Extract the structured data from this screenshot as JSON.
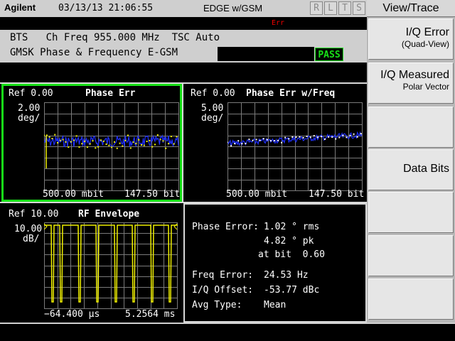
{
  "header": {
    "brand": "Agilent",
    "datetime": "03/13/13 21:06:55",
    "mode": "EDGE w/GSM",
    "indicators": [
      "R",
      "L",
      "T",
      "S"
    ]
  },
  "messages": {
    "error": "Err"
  },
  "info": {
    "line1": "BTS   Ch Freq 955.000 MHz  TSC Auto",
    "line2": "GMSK Phase & Frequency E-GSM",
    "result": "PASS"
  },
  "menu": {
    "title": "View/Trace",
    "softkeys": [
      {
        "label": "I/Q Error",
        "sub": "(Quad-View)"
      },
      {
        "label": "I/Q Measured",
        "sub": "Polar Vector"
      },
      {
        "label": "",
        "sub": ""
      },
      {
        "label": "Data Bits",
        "sub": ""
      },
      {
        "label": "",
        "sub": ""
      },
      {
        "label": "",
        "sub": ""
      },
      {
        "label": "",
        "sub": ""
      }
    ]
  },
  "panels": {
    "phase_err": {
      "ref": "Ref 0.00",
      "title": "Phase Err",
      "scale": "2.00",
      "unit": "deg/",
      "x_start": "500.00 mbit",
      "x_end": "147.50 bit"
    },
    "phase_err_freq": {
      "ref": "Ref 0.00",
      "title": "Phase Err w/Freq",
      "scale": "5.00",
      "unit": "deg/",
      "x_start": "500.00 mbit",
      "x_end": "147.50 bit"
    },
    "rf_envelope": {
      "ref": "Ref 10.00",
      "title": "RF Envelope",
      "scale": "10.00",
      "unit": "dB/",
      "x_start": "−64.400 µs",
      "x_end": "5.2564 ms"
    }
  },
  "results": {
    "phase_error_label": "Phase Error:",
    "phase_error_rms": "1.02 ° rms",
    "phase_error_pk": "4.82 ° pk",
    "at_bit": "at bit  0.60",
    "freq_error_label": "Freq Error:",
    "freq_error_value": "24.53 Hz",
    "iq_offset_label": "I/Q Offset:",
    "iq_offset_value": "-53.77 dBc",
    "avg_type_label": "Avg Type:",
    "avg_type_value": "Mean"
  },
  "colors": {
    "trace_yellow": "#f0f000",
    "trace_blue": "#2030ff",
    "grid": "#7a7a7a",
    "active_border": "#18e018"
  }
}
